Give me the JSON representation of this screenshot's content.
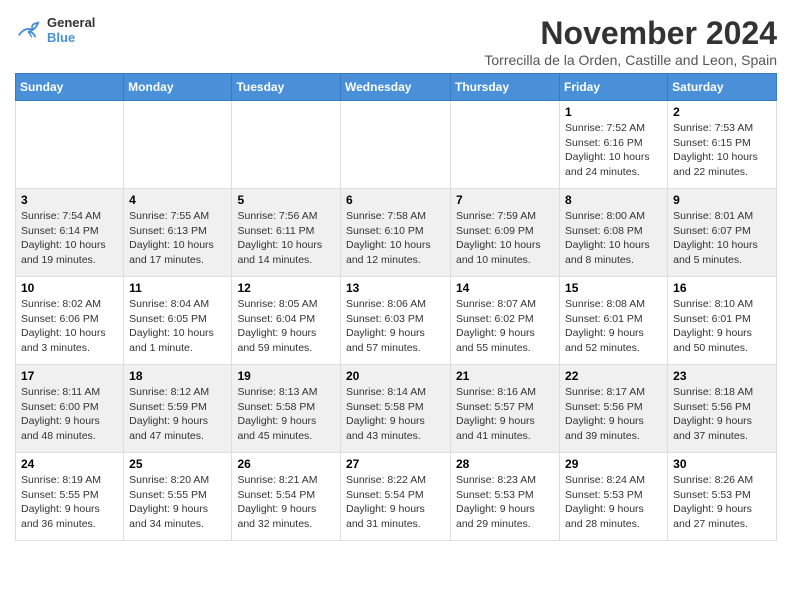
{
  "header": {
    "logo_line1": "General",
    "logo_line2": "Blue",
    "month_title": "November 2024",
    "subtitle": "Torrecilla de la Orden, Castille and Leon, Spain"
  },
  "calendar": {
    "days_of_week": [
      "Sunday",
      "Monday",
      "Tuesday",
      "Wednesday",
      "Thursday",
      "Friday",
      "Saturday"
    ],
    "weeks": [
      [
        {
          "day": "",
          "info": ""
        },
        {
          "day": "",
          "info": ""
        },
        {
          "day": "",
          "info": ""
        },
        {
          "day": "",
          "info": ""
        },
        {
          "day": "",
          "info": ""
        },
        {
          "day": "1",
          "info": "Sunrise: 7:52 AM\nSunset: 6:16 PM\nDaylight: 10 hours and 24 minutes."
        },
        {
          "day": "2",
          "info": "Sunrise: 7:53 AM\nSunset: 6:15 PM\nDaylight: 10 hours and 22 minutes."
        }
      ],
      [
        {
          "day": "3",
          "info": "Sunrise: 7:54 AM\nSunset: 6:14 PM\nDaylight: 10 hours and 19 minutes."
        },
        {
          "day": "4",
          "info": "Sunrise: 7:55 AM\nSunset: 6:13 PM\nDaylight: 10 hours and 17 minutes."
        },
        {
          "day": "5",
          "info": "Sunrise: 7:56 AM\nSunset: 6:11 PM\nDaylight: 10 hours and 14 minutes."
        },
        {
          "day": "6",
          "info": "Sunrise: 7:58 AM\nSunset: 6:10 PM\nDaylight: 10 hours and 12 minutes."
        },
        {
          "day": "7",
          "info": "Sunrise: 7:59 AM\nSunset: 6:09 PM\nDaylight: 10 hours and 10 minutes."
        },
        {
          "day": "8",
          "info": "Sunrise: 8:00 AM\nSunset: 6:08 PM\nDaylight: 10 hours and 8 minutes."
        },
        {
          "day": "9",
          "info": "Sunrise: 8:01 AM\nSunset: 6:07 PM\nDaylight: 10 hours and 5 minutes."
        }
      ],
      [
        {
          "day": "10",
          "info": "Sunrise: 8:02 AM\nSunset: 6:06 PM\nDaylight: 10 hours and 3 minutes."
        },
        {
          "day": "11",
          "info": "Sunrise: 8:04 AM\nSunset: 6:05 PM\nDaylight: 10 hours and 1 minute."
        },
        {
          "day": "12",
          "info": "Sunrise: 8:05 AM\nSunset: 6:04 PM\nDaylight: 9 hours and 59 minutes."
        },
        {
          "day": "13",
          "info": "Sunrise: 8:06 AM\nSunset: 6:03 PM\nDaylight: 9 hours and 57 minutes."
        },
        {
          "day": "14",
          "info": "Sunrise: 8:07 AM\nSunset: 6:02 PM\nDaylight: 9 hours and 55 minutes."
        },
        {
          "day": "15",
          "info": "Sunrise: 8:08 AM\nSunset: 6:01 PM\nDaylight: 9 hours and 52 minutes."
        },
        {
          "day": "16",
          "info": "Sunrise: 8:10 AM\nSunset: 6:01 PM\nDaylight: 9 hours and 50 minutes."
        }
      ],
      [
        {
          "day": "17",
          "info": "Sunrise: 8:11 AM\nSunset: 6:00 PM\nDaylight: 9 hours and 48 minutes."
        },
        {
          "day": "18",
          "info": "Sunrise: 8:12 AM\nSunset: 5:59 PM\nDaylight: 9 hours and 47 minutes."
        },
        {
          "day": "19",
          "info": "Sunrise: 8:13 AM\nSunset: 5:58 PM\nDaylight: 9 hours and 45 minutes."
        },
        {
          "day": "20",
          "info": "Sunrise: 8:14 AM\nSunset: 5:58 PM\nDaylight: 9 hours and 43 minutes."
        },
        {
          "day": "21",
          "info": "Sunrise: 8:16 AM\nSunset: 5:57 PM\nDaylight: 9 hours and 41 minutes."
        },
        {
          "day": "22",
          "info": "Sunrise: 8:17 AM\nSunset: 5:56 PM\nDaylight: 9 hours and 39 minutes."
        },
        {
          "day": "23",
          "info": "Sunrise: 8:18 AM\nSunset: 5:56 PM\nDaylight: 9 hours and 37 minutes."
        }
      ],
      [
        {
          "day": "24",
          "info": "Sunrise: 8:19 AM\nSunset: 5:55 PM\nDaylight: 9 hours and 36 minutes."
        },
        {
          "day": "25",
          "info": "Sunrise: 8:20 AM\nSunset: 5:55 PM\nDaylight: 9 hours and 34 minutes."
        },
        {
          "day": "26",
          "info": "Sunrise: 8:21 AM\nSunset: 5:54 PM\nDaylight: 9 hours and 32 minutes."
        },
        {
          "day": "27",
          "info": "Sunrise: 8:22 AM\nSunset: 5:54 PM\nDaylight: 9 hours and 31 minutes."
        },
        {
          "day": "28",
          "info": "Sunrise: 8:23 AM\nSunset: 5:53 PM\nDaylight: 9 hours and 29 minutes."
        },
        {
          "day": "29",
          "info": "Sunrise: 8:24 AM\nSunset: 5:53 PM\nDaylight: 9 hours and 28 minutes."
        },
        {
          "day": "30",
          "info": "Sunrise: 8:26 AM\nSunset: 5:53 PM\nDaylight: 9 hours and 27 minutes."
        }
      ]
    ]
  }
}
